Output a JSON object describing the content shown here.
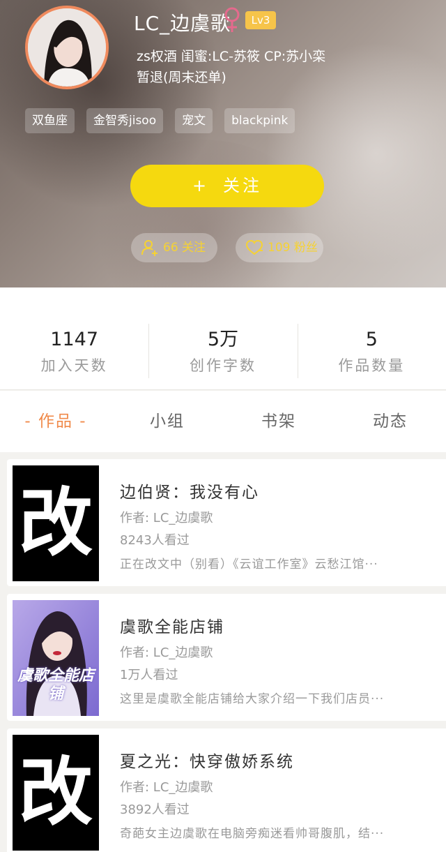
{
  "profile": {
    "username": "LC_边虞歌",
    "level": "Lv3",
    "bio_line1": "zs权酒 闺蜜:LC-苏筱 CP:苏小栾",
    "bio_line2": "暂退(周末还单)",
    "tags": [
      "双鱼座",
      "金智秀jisoo",
      "宠文",
      "blackpink"
    ],
    "follow_button": "关注",
    "following": "66 关注",
    "fans": "109 粉丝"
  },
  "stats": [
    {
      "value": "1147",
      "label": "加入天数"
    },
    {
      "value": "5万",
      "label": "创作字数"
    },
    {
      "value": "5",
      "label": "作品数量"
    }
  ],
  "tabs": [
    "- 作品 -",
    "小组",
    "书架",
    "动态"
  ],
  "works": [
    {
      "cover_text": "改",
      "title": "边伯贤：我没有心",
      "author": "作者: LC_边虞歌",
      "views": "8243人看过",
      "desc": "正在改文中（别看）《云谊工作室》云愁江馆···"
    },
    {
      "cover_text": "虞歌全能店铺",
      "title": "虞歌全能店铺",
      "author": "作者: LC_边虞歌",
      "views": "1万人看过",
      "desc": "这里是虞歌全能店铺给大家介绍一下我们店员···"
    },
    {
      "cover_text": "改",
      "title": "夏之光：快穿傲娇系统",
      "author": "作者: LC_边虞歌",
      "views": "3892人看过",
      "desc": "奇葩女主边虞歌在电脑旁痴迷看帅哥腹肌，结···"
    }
  ],
  "colors": {
    "accent": "#f08a4a",
    "follow_button": "#f5d90f",
    "level_badge": "#f6c44a",
    "gender_icon": "#e56a8d",
    "stat_pill_text": "#f6d232"
  }
}
